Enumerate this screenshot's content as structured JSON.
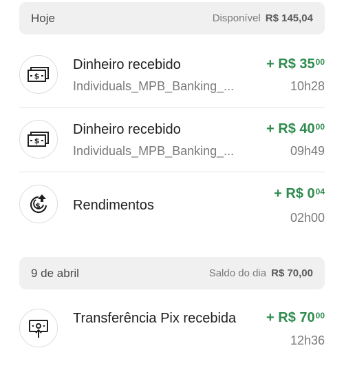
{
  "today_header": {
    "title": "Hoje",
    "balance_label": "Disponível",
    "balance_value": "R$  145,04"
  },
  "today_items": [
    {
      "title": "Dinheiro recebido",
      "subtitle": "Individuals_MPB_Banking_...",
      "amount_main": "+ R$ 35",
      "amount_cents": "00",
      "time": "10h28",
      "icon": "cash-icon"
    },
    {
      "title": "Dinheiro recebido",
      "subtitle": "Individuals_MPB_Banking_...",
      "amount_main": "+ R$ 40",
      "amount_cents": "00",
      "time": "09h49",
      "icon": "cash-icon"
    },
    {
      "title": "Rendimentos",
      "amount_main": "+ R$ 0",
      "amount_cents": "04",
      "time": "02h00",
      "icon": "yield-icon"
    }
  ],
  "april_header": {
    "title": "9 de abril",
    "balance_label": "Saldo do dia",
    "balance_value": "R$  70,00"
  },
  "april_items": [
    {
      "title": "Transferência Pix recebida",
      "subtitle": "·",
      "amount_main": "+ R$ 70",
      "amount_cents": "00",
      "time": "12h36",
      "icon": "pix-transfer-icon"
    }
  ],
  "colors": {
    "positive": "#2e8b4e",
    "header_bg": "#f0f0f0"
  }
}
